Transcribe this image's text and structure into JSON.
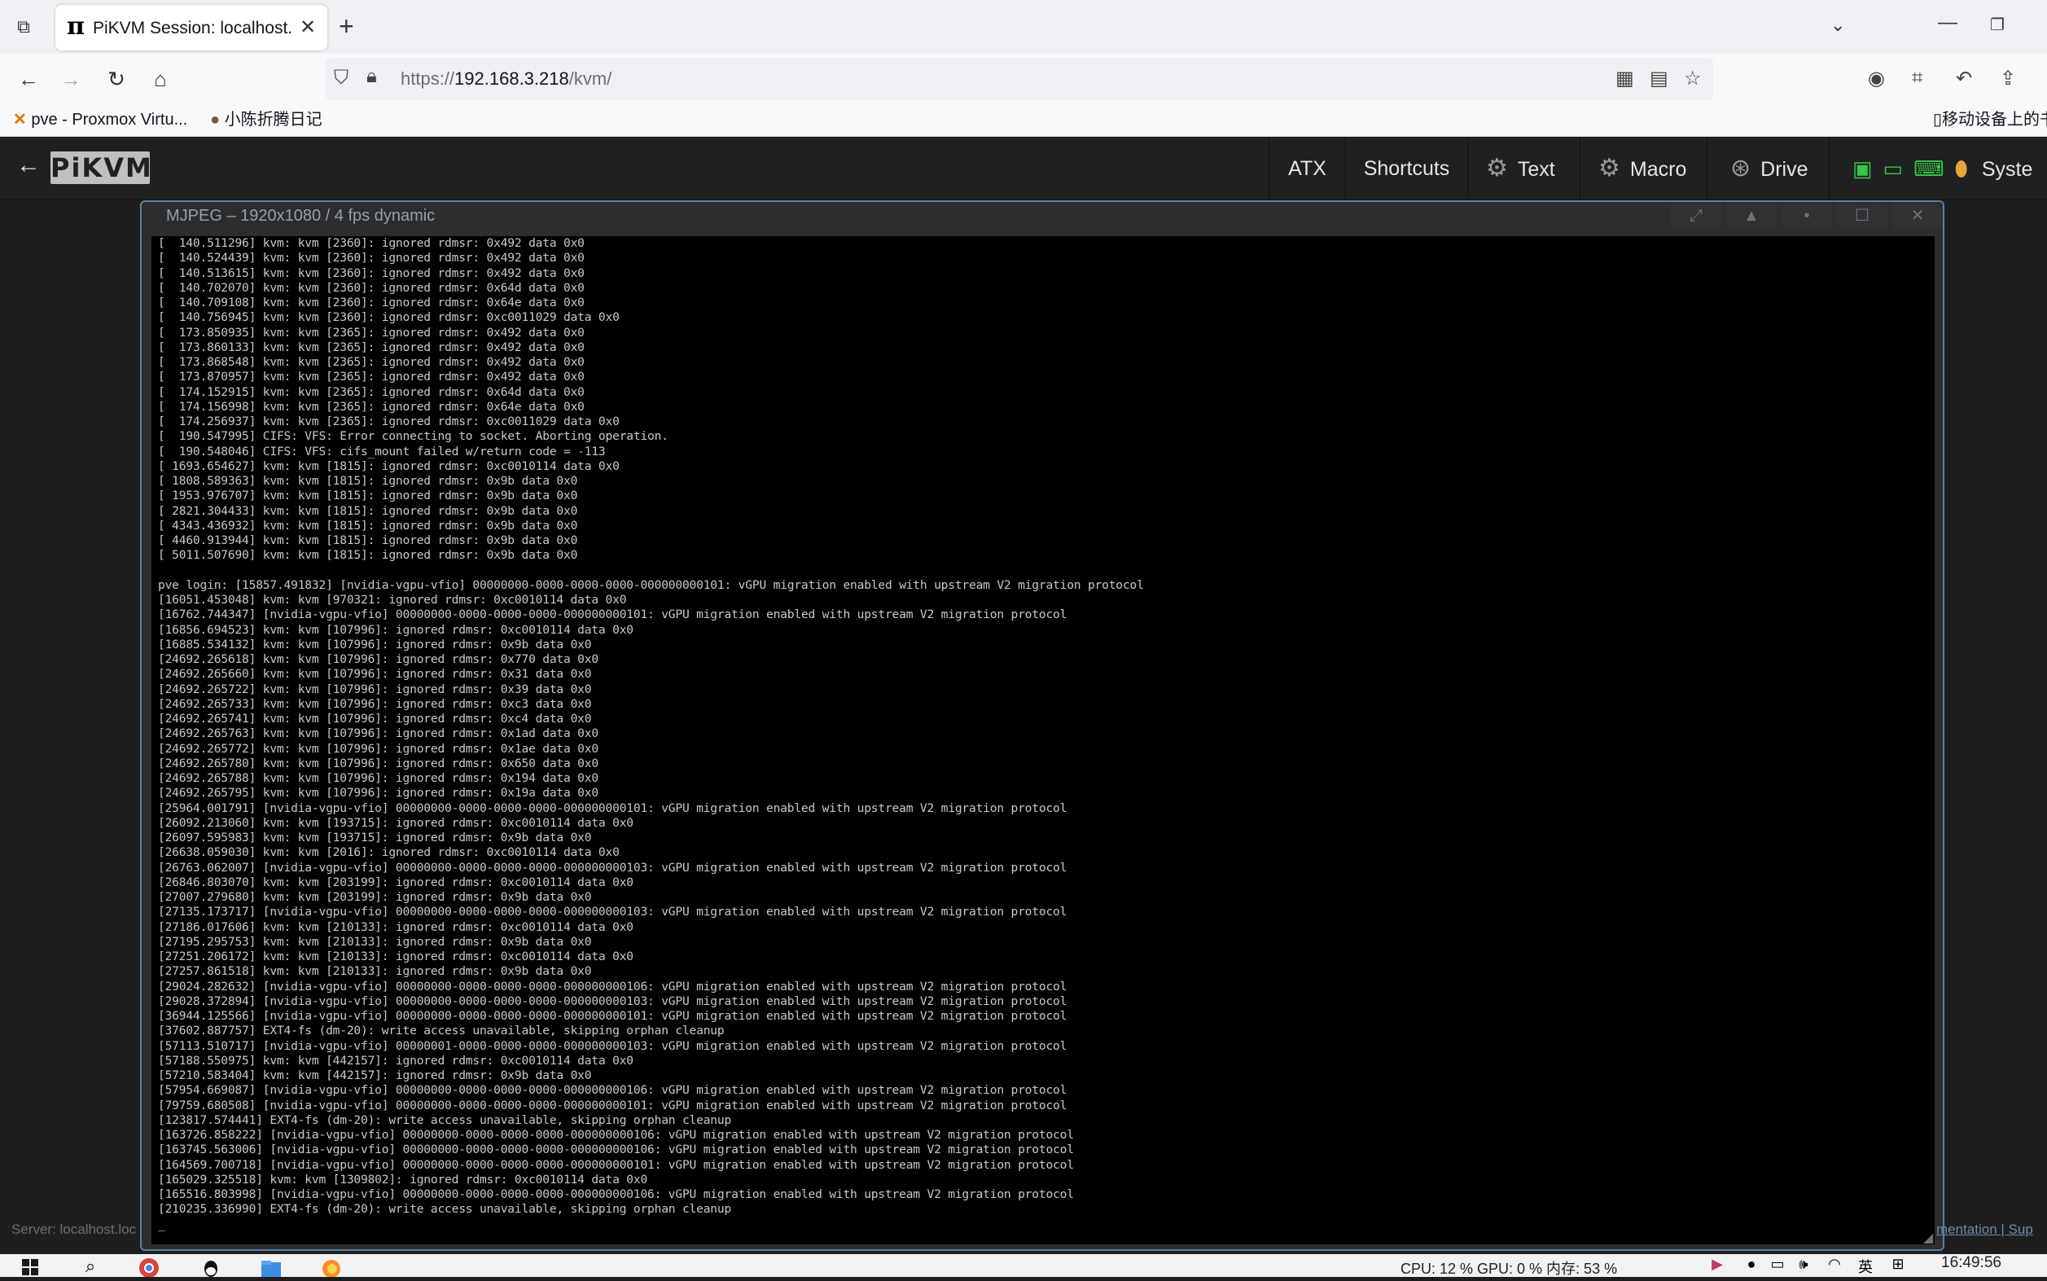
{
  "browser": {
    "tab_title": "PiKVM Session: localhost.loc",
    "favicon": "π",
    "url_prefix": "https://",
    "url_host": "192.168.3.218",
    "url_path": "/kvm/",
    "bookmarks": [
      {
        "label": "pve - Proxmox Virtu...",
        "icon": "proxmox-icon"
      },
      {
        "label": "小陈折腾日记",
        "icon": "avatar-icon"
      }
    ],
    "mobile_bookmarks": "移动设备上的书"
  },
  "pikvm": {
    "logo": "PiKVM",
    "menu": {
      "atx": "ATX",
      "shortcuts": "Shortcuts",
      "text": "Text",
      "macro": "Macro",
      "drive": "Drive",
      "system": "Syste"
    },
    "stream_title": "MJPEG – 1920x1080 / 4 fps dynamic",
    "server_info": "Server: localhost.loc",
    "footer_links": "mentation  |  Sup"
  },
  "console_lines": [
    "[  140.511296] kvm: kvm [2360]: ignored rdmsr: 0x492 data 0x0",
    "[  140.524439] kvm: kvm [2360]: ignored rdmsr: 0x492 data 0x0",
    "[  140.513615] kvm: kvm [2360]: ignored rdmsr: 0x492 data 0x0",
    "[  140.702070] kvm: kvm [2360]: ignored rdmsr: 0x64d data 0x0",
    "[  140.709108] kvm: kvm [2360]: ignored rdmsr: 0x64e data 0x0",
    "[  140.756945] kvm: kvm [2360]: ignored rdmsr: 0xc0011029 data 0x0",
    "[  173.850935] kvm: kvm [2365]: ignored rdmsr: 0x492 data 0x0",
    "[  173.860133] kvm: kvm [2365]: ignored rdmsr: 0x492 data 0x0",
    "[  173.868548] kvm: kvm [2365]: ignored rdmsr: 0x492 data 0x0",
    "[  173.870957] kvm: kvm [2365]: ignored rdmsr: 0x492 data 0x0",
    "[  174.152915] kvm: kvm [2365]: ignored rdmsr: 0x64d data 0x0",
    "[  174.156998] kvm: kvm [2365]: ignored rdmsr: 0x64e data 0x0",
    "[  174.256937] kvm: kvm [2365]: ignored rdmsr: 0xc0011029 data 0x0",
    "[  190.547995] CIFS: VFS: Error connecting to socket. Aborting operation.",
    "[  190.548046] CIFS: VFS: cifs_mount failed w/return code = -113",
    "[ 1693.654627] kvm: kvm [1815]: ignored rdmsr: 0xc0010114 data 0x0",
    "[ 1808.589363] kvm: kvm [1815]: ignored rdmsr: 0x9b data 0x0",
    "[ 1953.976707] kvm: kvm [1815]: ignored rdmsr: 0x9b data 0x0",
    "[ 2821.304433] kvm: kvm [1815]: ignored rdmsr: 0x9b data 0x0",
    "[ 4343.436932] kvm: kvm [1815]: ignored rdmsr: 0x9b data 0x0",
    "[ 4460.913944] kvm: kvm [1815]: ignored rdmsr: 0x9b data 0x0",
    "[ 5011.507690] kvm: kvm [1815]: ignored rdmsr: 0x9b data 0x0",
    "",
    "pve login: [15857.491832] [nvidia-vgpu-vfio] 00000000-0000-0000-0000-000000000101: vGPU migration enabled with upstream V2 migration protocol",
    "[16051.453048] kvm: kvm [970321: ignored rdmsr: 0xc0010114 data 0x0",
    "[16762.744347] [nvidia-vgpu-vfio] 00000000-0000-0000-0000-000000000101: vGPU migration enabled with upstream V2 migration protocol",
    "[16856.694523] kvm: kvm [107996]: ignored rdmsr: 0xc0010114 data 0x0",
    "[16885.534132] kvm: kvm [107996]: ignored rdmsr: 0x9b data 0x0",
    "[24692.265618] kvm: kvm [107996]: ignored rdmsr: 0x770 data 0x0",
    "[24692.265660] kvm: kvm [107996]: ignored rdmsr: 0x31 data 0x0",
    "[24692.265722] kvm: kvm [107996]: ignored rdmsr: 0x39 data 0x0",
    "[24692.265733] kvm: kvm [107996]: ignored rdmsr: 0xc3 data 0x0",
    "[24692.265741] kvm: kvm [107996]: ignored rdmsr: 0xc4 data 0x0",
    "[24692.265763] kvm: kvm [107996]: ignored rdmsr: 0x1ad data 0x0",
    "[24692.265772] kvm: kvm [107996]: ignored rdmsr: 0x1ae data 0x0",
    "[24692.265780] kvm: kvm [107996]: ignored rdmsr: 0x650 data 0x0",
    "[24692.265788] kvm: kvm [107996]: ignored rdmsr: 0x194 data 0x0",
    "[24692.265795] kvm: kvm [107996]: ignored rdmsr: 0x19a data 0x0",
    "[25964.001791] [nvidia-vgpu-vfio] 00000000-0000-0000-0000-000000000101: vGPU migration enabled with upstream V2 migration protocol",
    "[26092.213060] kvm: kvm [193715]: ignored rdmsr: 0xc0010114 data 0x0",
    "[26097.595983] kvm: kvm [193715]: ignored rdmsr: 0x9b data 0x0",
    "[26638.059030] kvm: kvm [2016]: ignored rdmsr: 0xc0010114 data 0x0",
    "[26763.062007] [nvidia-vgpu-vfio] 00000000-0000-0000-0000-000000000103: vGPU migration enabled with upstream V2 migration protocol",
    "[26846.803070] kvm: kvm [203199]: ignored rdmsr: 0xc0010114 data 0x0",
    "[27007.279680] kvm: kvm [203199]: ignored rdmsr: 0x9b data 0x0",
    "[27135.173717] [nvidia-vgpu-vfio] 00000000-0000-0000-0000-000000000103: vGPU migration enabled with upstream V2 migration protocol",
    "[27186.017606] kvm: kvm [210133]: ignored rdmsr: 0xc0010114 data 0x0",
    "[27195.295753] kvm: kvm [210133]: ignored rdmsr: 0x9b data 0x0",
    "[27251.206172] kvm: kvm [210133]: ignored rdmsr: 0xc0010114 data 0x0",
    "[27257.861518] kvm: kvm [210133]: ignored rdmsr: 0x9b data 0x0",
    "[29024.282632] [nvidia-vgpu-vfio] 00000000-0000-0000-0000-000000000106: vGPU migration enabled with upstream V2 migration protocol",
    "[29028.372894] [nvidia-vgpu-vfio] 00000000-0000-0000-0000-000000000103: vGPU migration enabled with upstream V2 migration protocol",
    "[36944.125566] [nvidia-vgpu-vfio] 00000000-0000-0000-0000-000000000101: vGPU migration enabled with upstream V2 migration protocol",
    "[37602.887757] EXT4-fs (dm-20): write access unavailable, skipping orphan cleanup",
    "[57113.510717] [nvidia-vgpu-vfio] 00000001-0000-0000-0000-000000000103: vGPU migration enabled with upstream V2 migration protocol",
    "[57188.550975] kvm: kvm [442157]: ignored rdmsr: 0xc0010114 data 0x0",
    "[57210.583404] kvm: kvm [442157]: ignored rdmsr: 0x9b data 0x0",
    "[57954.669087] [nvidia-vgpu-vfio] 00000000-0000-0000-0000-000000000106: vGPU migration enabled with upstream V2 migration protocol",
    "[79759.680508] [nvidia-vgpu-vfio] 00000000-0000-0000-0000-000000000101: vGPU migration enabled with upstream V2 migration protocol",
    "[123817.574441] EXT4-fs (dm-20): write access unavailable, skipping orphan cleanup",
    "[163726.858222] [nvidia-vgpu-vfio] 00000000-0000-0000-0000-000000000106: vGPU migration enabled with upstream V2 migration protocol",
    "[163745.563006] [nvidia-vgpu-vfio] 00000000-0000-0000-0000-000000000106: vGPU migration enabled with upstream V2 migration protocol",
    "[164569.700718] [nvidia-vgpu-vfio] 00000000-0000-0000-0000-000000000101: vGPU migration enabled with upstream V2 migration protocol",
    "[165029.325518] kvm: kvm [1309802]: ignored rdmsr: 0xc0010114 data 0x0",
    "[165516.803998] [nvidia-vgpu-vfio] 00000000-0000-0000-0000-000000000106: vGPU migration enabled with upstream V2 migration protocol",
    "[210235.336990] EXT4-fs (dm-20): write access unavailable, skipping orphan cleanup",
    "_"
  ],
  "taskbar": {
    "stats": "CPU: 12 %  GPU: 0 %     内存: 53 %",
    "clock": "16:49:56"
  },
  "colors": {
    "header_bg": "#1f2021",
    "stream_border": "#5a7fa8",
    "status_green": "#35c94a",
    "mouse_orange": "#e8a33c"
  }
}
